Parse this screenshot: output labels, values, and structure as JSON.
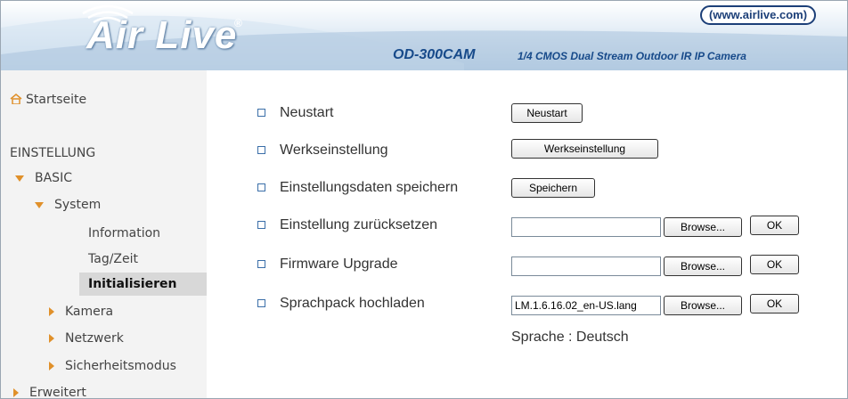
{
  "header": {
    "logo": "Air Live",
    "url_badge": "(www.airlive.com)",
    "model": "OD-300CAM",
    "model_desc": "1/4 CMOS Dual Stream Outdoor IR IP Camera"
  },
  "sidebar": {
    "home": "Startseite",
    "section": "EINSTELLUNG",
    "basic": "BASIC",
    "system": "System",
    "information": "Information",
    "tagzeit": "Tag/Zeit",
    "initialisieren": "Initialisieren",
    "kamera": "Kamera",
    "netzwerk": "Netzwerk",
    "sicherheit": "Sicherheitsmodus",
    "erweitert": "Erweitert"
  },
  "main": {
    "rows": [
      {
        "label": "Neustart",
        "button": "Neustart"
      },
      {
        "label": "Werkseinstellung",
        "button": "Werkseinstellung"
      },
      {
        "label": "Einstellungsdaten speichern",
        "button": "Speichern"
      },
      {
        "label": "Einstellung zurücksetzen",
        "file_value": "",
        "browse": "Browse...",
        "ok": "OK"
      },
      {
        "label": "Firmware Upgrade",
        "file_value": "",
        "browse": "Browse...",
        "ok": "OK"
      },
      {
        "label": "Sprachpack hochladen",
        "file_value": "LM.1.6.16.02_en-US.lang",
        "browse": "Browse...",
        "ok": "OK"
      }
    ],
    "language_info": "Sprache : Deutsch"
  },
  "colors": {
    "accent": "#174a8a",
    "sidebar_bg": "#f3f3f3",
    "arrow": "#e0902a"
  }
}
